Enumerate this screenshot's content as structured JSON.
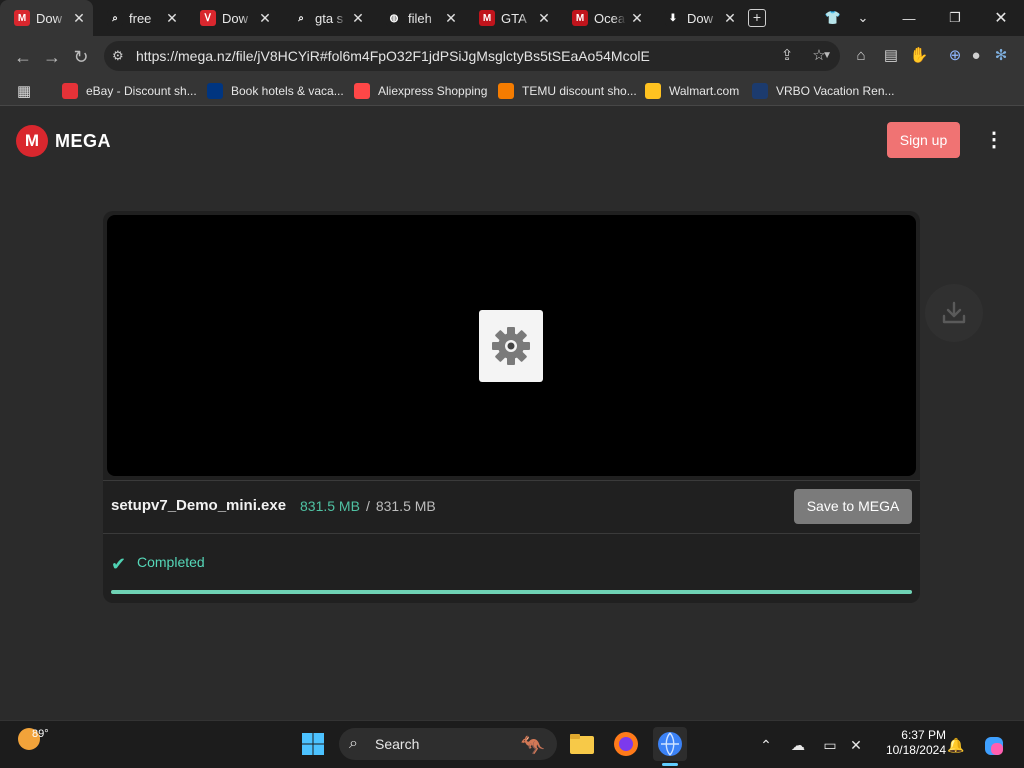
{
  "browser": {
    "tabs": [
      {
        "title": "Dow",
        "favicon": "mega-icon",
        "color": "#d9272e",
        "active": true
      },
      {
        "title": "free",
        "favicon": "search-icon",
        "color": "#1f1f1f"
      },
      {
        "title": "Dow",
        "favicon": "pdf-icon",
        "color": "#d9272e"
      },
      {
        "title": "gta s",
        "favicon": "search-icon",
        "color": "#1f1f1f"
      },
      {
        "title": "fileh",
        "favicon": "globe-icon",
        "color": "#1f1f1f"
      },
      {
        "title": "GTA",
        "favicon": "mega-icon",
        "color": "#c0141c"
      },
      {
        "title": "Ocea",
        "favicon": "mega-icon",
        "color": "#c0141c"
      },
      {
        "title": "Dow",
        "favicon": "download-icon",
        "color": "#1f1f1f"
      }
    ],
    "new_tab_label": "+",
    "url": "https://mega.nz/file/jV8HCYiR#fol6m4FpO32F1jdPSiJgMsglctyBs5tSEaAo54McolE",
    "bookmarks": [
      {
        "label": "eBay - Discount sh...",
        "icon": "ebay-icon",
        "color": "#e53238"
      },
      {
        "label": "Book hotels & vaca...",
        "icon": "booking-icon",
        "color": "#003580"
      },
      {
        "label": "Aliexpress Shopping",
        "icon": "aliexpress-icon",
        "color": "#ff4747"
      },
      {
        "label": "TEMU discount sho...",
        "icon": "temu-icon",
        "color": "#f57c00"
      },
      {
        "label": "Walmart.com",
        "icon": "walmart-icon",
        "color": "#ffc220"
      },
      {
        "label": "VRBO Vacation Ren...",
        "icon": "vrbo-icon",
        "color": "#1c3b6e"
      }
    ]
  },
  "mega": {
    "brand": "MEGA",
    "logo_letter": "M",
    "signup_label": "Sign up",
    "file_name": "setupv7_Demo_mini.exe",
    "downloaded": "831.5 MB",
    "separator": "/",
    "total": "831.5 MB",
    "save_label": "Save to MEGA",
    "status": "Completed",
    "progress": 1.0,
    "accent": "#4fc2a3",
    "brand_color": "#d9272e"
  },
  "taskbar": {
    "weather_temp": "89°",
    "search_label": "Search",
    "time": "6:37 PM",
    "date": "10/18/2024"
  }
}
